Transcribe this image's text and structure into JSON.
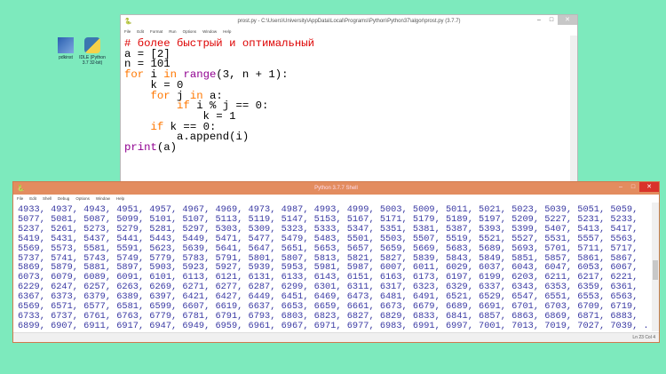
{
  "desktop": {
    "icons": [
      {
        "label": "pdkinst",
        "icon": "app-icon"
      },
      {
        "label": "IDLE (Python 3.7 32-bit)",
        "icon": "python-icon"
      }
    ]
  },
  "editor": {
    "title": "prost.py - C:\\Users\\University\\AppData\\Local\\Programs\\Python\\Python37\\algor\\prost.py (3.7.7)",
    "menu": [
      "File",
      "Edit",
      "Format",
      "Run",
      "Options",
      "Window",
      "Help"
    ],
    "lines": [
      [
        {
          "t": "# более быстрый и оптимальный",
          "c": "comment"
        }
      ],
      [
        {
          "t": "a = [2]",
          "c": "default"
        }
      ],
      [
        {
          "t": "n = 101",
          "c": "default"
        }
      ],
      [
        {
          "t": "for",
          "c": "keyword"
        },
        {
          "t": " i ",
          "c": "default"
        },
        {
          "t": "in",
          "c": "keyword"
        },
        {
          "t": " ",
          "c": "default"
        },
        {
          "t": "range",
          "c": "builtin"
        },
        {
          "t": "(3, n + 1):",
          "c": "default"
        }
      ],
      [
        {
          "t": "    k = 0",
          "c": "default"
        }
      ],
      [
        {
          "t": "    ",
          "c": "default"
        },
        {
          "t": "for",
          "c": "keyword"
        },
        {
          "t": " j ",
          "c": "default"
        },
        {
          "t": "in",
          "c": "keyword"
        },
        {
          "t": " a:",
          "c": "default"
        }
      ],
      [
        {
          "t": "        ",
          "c": "default"
        },
        {
          "t": "if",
          "c": "keyword"
        },
        {
          "t": " i % j == 0:",
          "c": "default"
        }
      ],
      [
        {
          "t": "            k = 1",
          "c": "default"
        }
      ],
      [
        {
          "t": "    ",
          "c": "default"
        },
        {
          "t": "if",
          "c": "keyword"
        },
        {
          "t": " k == 0:",
          "c": "default"
        }
      ],
      [
        {
          "t": "        a.append(i)",
          "c": "default"
        }
      ],
      [
        {
          "t": "print",
          "c": "builtin"
        },
        {
          "t": "(a)",
          "c": "default"
        }
      ]
    ]
  },
  "shell": {
    "title": "Python 3.7.7 Shell",
    "menu": [
      "File",
      "Edit",
      "Shell",
      "Debug",
      "Options",
      "Window",
      "Help"
    ],
    "title_color": "#e38c5f",
    "output": [
      "4933, 4937, 4943, 4951, 4957, 4967, 4969, 4973, 4987, 4993, 4999, 5003, 5009, 5011, 5021, 5023, 5039, 5051, 5059,",
      "5077, 5081, 5087, 5099, 5101, 5107, 5113, 5119, 5147, 5153, 5167, 5171, 5179, 5189, 5197, 5209, 5227, 5231, 5233,",
      "5237, 5261, 5273, 5279, 5281, 5297, 5303, 5309, 5323, 5333, 5347, 5351, 5381, 5387, 5393, 5399, 5407, 5413, 5417,",
      "5419, 5431, 5437, 5441, 5443, 5449, 5471, 5477, 5479, 5483, 5501, 5503, 5507, 5519, 5521, 5527, 5531, 5557, 5563,",
      "5569, 5573, 5581, 5591, 5623, 5639, 5641, 5647, 5651, 5653, 5657, 5659, 5669, 5683, 5689, 5693, 5701, 5711, 5717,",
      "5737, 5741, 5743, 5749, 5779, 5783, 5791, 5801, 5807, 5813, 5821, 5827, 5839, 5843, 5849, 5851, 5857, 5861, 5867,",
      "5869, 5879, 5881, 5897, 5903, 5923, 5927, 5939, 5953, 5981, 5987, 6007, 6011, 6029, 6037, 6043, 6047, 6053, 6067,",
      "6073, 6079, 6089, 6091, 6101, 6113, 6121, 6131, 6133, 6143, 6151, 6163, 6173, 6197, 6199, 6203, 6211, 6217, 6221,",
      "6229, 6247, 6257, 6263, 6269, 6271, 6277, 6287, 6299, 6301, 6311, 6317, 6323, 6329, 6337, 6343, 6353, 6359, 6361,",
      "6367, 6373, 6379, 6389, 6397, 6421, 6427, 6449, 6451, 6469, 6473, 6481, 6491, 6521, 6529, 6547, 6551, 6553, 6563,",
      "6569, 6571, 6577, 6581, 6599, 6607, 6619, 6637, 6653, 6659, 6661, 6673, 6679, 6689, 6691, 6701, 6703, 6709, 6719,",
      "6733, 6737, 6761, 6763, 6779, 6781, 6791, 6793, 6803, 6823, 6827, 6829, 6833, 6841, 6857, 6863, 6869, 6871, 6883,",
      "6899, 6907, 6911, 6917, 6947, 6949, 6959, 6961, 6967, 6971, 6977, 6983, 6991, 6997, 7001, 7013, 7019, 7027, 7039, ."
    ],
    "status": "Ln 23  Col 4"
  },
  "controls": {
    "minimize": "–",
    "maximize": "□",
    "close": "✕"
  }
}
